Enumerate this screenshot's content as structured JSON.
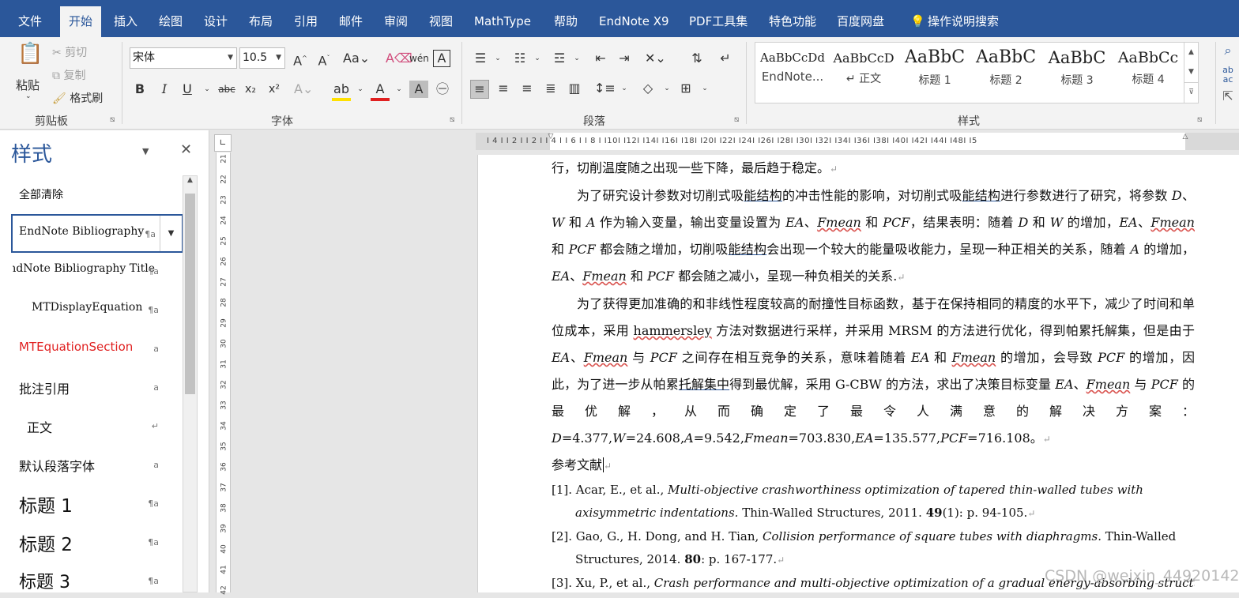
{
  "tabs": [
    {
      "label": "文件",
      "active": false
    },
    {
      "label": "开始",
      "active": true
    },
    {
      "label": "插入",
      "active": false
    },
    {
      "label": "绘图",
      "active": false
    },
    {
      "label": "设计",
      "active": false
    },
    {
      "label": "布局",
      "active": false
    },
    {
      "label": "引用",
      "active": false
    },
    {
      "label": "邮件",
      "active": false
    },
    {
      "label": "审阅",
      "active": false
    },
    {
      "label": "视图",
      "active": false
    },
    {
      "label": "MathType",
      "active": false
    },
    {
      "label": "帮助",
      "active": false
    },
    {
      "label": "EndNote X9",
      "active": false
    },
    {
      "label": "PDF工具集",
      "active": false
    },
    {
      "label": "特色功能",
      "active": false
    },
    {
      "label": "百度网盘",
      "active": false
    }
  ],
  "tell_me": "操作说明搜索",
  "clipboard": {
    "paste": "粘贴",
    "cut": "剪切",
    "copy": "复制",
    "format_painter": "格式刷",
    "label": "剪贴板"
  },
  "font": {
    "name": "宋体",
    "size": "10.5",
    "label": "字体"
  },
  "paragraph": {
    "label": "段落"
  },
  "styles": {
    "label": "样式",
    "gallery": [
      {
        "preview": "AaBbCcDd",
        "name": "EndNote..."
      },
      {
        "preview": "AaBbCcD",
        "name": "↵ 正文"
      },
      {
        "preview": "AaBbC",
        "name": "标题 1"
      },
      {
        "preview": "AaBbC",
        "name": "标题 2"
      },
      {
        "preview": "AaBbC",
        "name": "标题 3"
      },
      {
        "preview": "AaBbCc",
        "name": "标题 4"
      }
    ]
  },
  "styles_pane": {
    "title": "样式",
    "items": [
      {
        "label": "全部清除",
        "mark": ""
      },
      {
        "label": "EndNote Bibliography",
        "mark": "¶a"
      },
      {
        "label": "EndNote Bibliography Title",
        "mark": "¶a"
      },
      {
        "label": "MTDisplayEquation",
        "mark": "¶a"
      },
      {
        "label": "MTEquationSection",
        "mark": "a"
      },
      {
        "label": "批注引用",
        "mark": "a"
      },
      {
        "label": "正文",
        "mark": "↵"
      },
      {
        "label": "默认段落字体",
        "mark": "a"
      },
      {
        "label": "标题 1",
        "mark": "¶a"
      },
      {
        "label": "标题 2",
        "mark": "¶a"
      },
      {
        "label": "标题 3",
        "mark": "¶a"
      }
    ]
  },
  "ruler": {
    "h_labels": "I 4 I   I 2 I        I 2 I    I 4 I    I 6 I    I 8 I    I10I    I12I    I14I    I16I    I18I    I20I    I22I    I24I    I26I    I28I    I30I    I32I    I34I    I36I    I38I    I40I    I42I    I44I           I48I    I5",
    "v_labels": [
      "21",
      "22",
      "23",
      "24",
      "25",
      "26",
      "27",
      "28",
      "29",
      "30",
      "31",
      "32",
      "33",
      "34",
      "35",
      "36",
      "37",
      "38",
      "39",
      "40",
      "41",
      "42"
    ]
  },
  "colors": {
    "accent": "#2b579a",
    "ribbon": "#f3f3f3",
    "red_style": "#e02020"
  },
  "document": {
    "line1": "行，切削温度随之出现一些下降，最后趋于稳定。",
    "para2": {
      "a": "为了研究设计参数对切削式吸",
      "b": "能结构",
      "c": "的冲击性能的影响，对切削式吸",
      "d": "能结构",
      "e": "进行参数进行了研究，将参数 ",
      "f": "D",
      "g": "、",
      "h": "W",
      "i": " 和 ",
      "j": "A",
      "k": " 作为输入变量，输出变量设置为 ",
      "l": "EA",
      "m": "、",
      "n": "Fmean",
      "o": " 和 ",
      "p": "PCF",
      "q": "，结果表明：随着 ",
      "r": "D",
      "s": " 和 ",
      "t": "W",
      "u": " 的增加，",
      "v": "EA",
      "w": "、",
      "x": "Fmean",
      "y": " 和 ",
      "z": "PCF",
      "aa": " 都会随之增加，切削吸",
      "ab": "能结构",
      "ac": "会出现一个较大的能量吸收能力，呈现一种正相关的关系，随着 ",
      "ad": "A",
      "ae": " 的增加，",
      "af": "EA",
      "ag": "、",
      "ah": "Fmean",
      "ai": " 和 ",
      "aj": "PCF",
      "ak": " 都会随之减小，呈现一种负相关的关系."
    },
    "para3": {
      "a": "为了获得更加准确的和非线性程度较高的耐撞性目标函数，基于在保持相同的精度的水平下，减少了时间和单位成本，采用 ",
      "b": "hammersley",
      "c": " 方法对数据进行采样，并采用 MRSM 的方法进行优化，得到帕累托解集，但是由于 ",
      "d": "EA",
      "e": "、",
      "f": "Fmean",
      "g": " 与 ",
      "h": "PCF",
      "i": " 之间存在相互竞争的关系，意味着随着 ",
      "j": "EA",
      "k": " 和 ",
      "l": "Fmean",
      "m": " 的增加，会导致 ",
      "n": "PCF",
      "o": " 的增加，因此，为了进一步从帕累",
      "p": "托解集中",
      "q": "得到最优解，采用 G-CBW 的方法，求出了决策目标变量 ",
      "r": "EA",
      "s": "、",
      "t": "Fmean",
      "u": " 与 ",
      "v": "PCF",
      "w": " 的最优解，从而确定了最令人满意的解决方案：",
      "x": "D",
      "y": "=4.377,",
      "z": "W",
      "aa": "=24.608,",
      "ab": "A",
      "ac": "=9.542,",
      "ad": "Fmean",
      "ae": "=703.830,",
      "af": "EA",
      "ag": "=135.577,",
      "ah": "PCF",
      "ai": "=716.108。"
    },
    "refs_heading": "参考文献",
    "refs": [
      {
        "num": "[1].",
        "authors": "Acar, E., et al., ",
        "title": "Multi-objective crashworthiness optimization of tapered thin-walled tubes with axisymmetric indentations.",
        "journal": " Thin-Walled Structures, 2011. ",
        "vol": "49",
        "rest": "(1): p. 94-105."
      },
      {
        "num": "[2].",
        "authors": "Gao, G., H. Dong, and H. Tian, ",
        "title": "Collision performance of square tubes with diaphragms.",
        "journal": " Thin-Walled Structures, 2014. ",
        "vol": "80",
        "rest": ": p. 167-177."
      },
      {
        "num": "[3].",
        "authors": "Xu, P., et al., ",
        "title": "Crash performance and multi-objective optimization of a gradual energy-absorbing structure for sub",
        "journal": "",
        "vol": "",
        "rest": ""
      }
    ]
  },
  "watermark": "CSDN @weixin_44920142"
}
